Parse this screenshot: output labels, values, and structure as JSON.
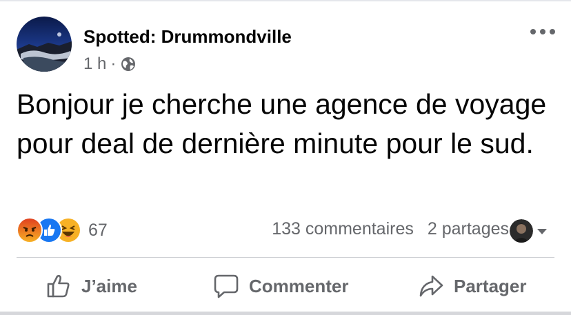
{
  "post": {
    "page_name": "Spotted: Drummondville",
    "time": "1 h",
    "separator": "·",
    "text": "Bonjour je cherche une agence de voyage pour deal de dernière minute pour le sud."
  },
  "reactions": {
    "icons": [
      "angry-icon",
      "like-icon",
      "haha-icon"
    ],
    "count": "67"
  },
  "stats": {
    "comments": "133 commentaires",
    "shares": "2 partages"
  },
  "actions": {
    "like_label": "J’aime",
    "comment_label": "Commenter",
    "share_label": "Partager"
  },
  "colors": {
    "text": "#050505",
    "secondary": "#65676b",
    "like_blue": "#1877f2",
    "angry": "#e9710f",
    "haha": "#f7b125"
  }
}
